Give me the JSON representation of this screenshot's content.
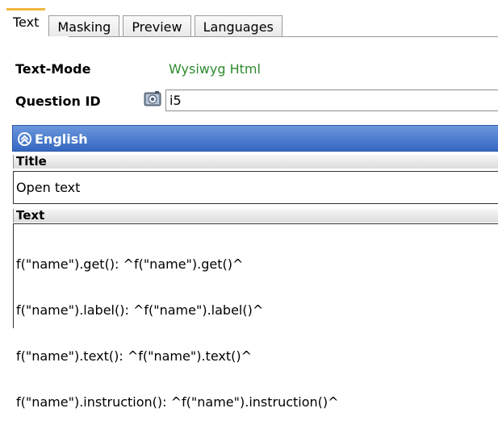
{
  "tabs": [
    {
      "label": "Text",
      "active": true
    },
    {
      "label": "Masking",
      "active": false
    },
    {
      "label": "Preview",
      "active": false
    },
    {
      "label": "Languages",
      "active": false
    }
  ],
  "text_mode": {
    "label": "Text-Mode",
    "value": "Wysiwyg Html"
  },
  "question_id": {
    "label": "Question ID",
    "value": "i5"
  },
  "section": {
    "title": "English",
    "title_field": {
      "label": "Title",
      "value": "Open text"
    },
    "text_field": {
      "label": "Text",
      "lines": [
        "f(\"name\").get(): ^f(\"name\").get()^",
        "f(\"name\").label(): ^f(\"name\").label()^",
        "f(\"name\").text(): ^f(\"name\").text()^",
        "f(\"name\").instruction(): ^f(\"name\").instruction()^"
      ]
    }
  },
  "colors": {
    "accent_tab": "#f2b640",
    "mode_value": "#2e8b2e",
    "panel_header": "#3467c1"
  }
}
